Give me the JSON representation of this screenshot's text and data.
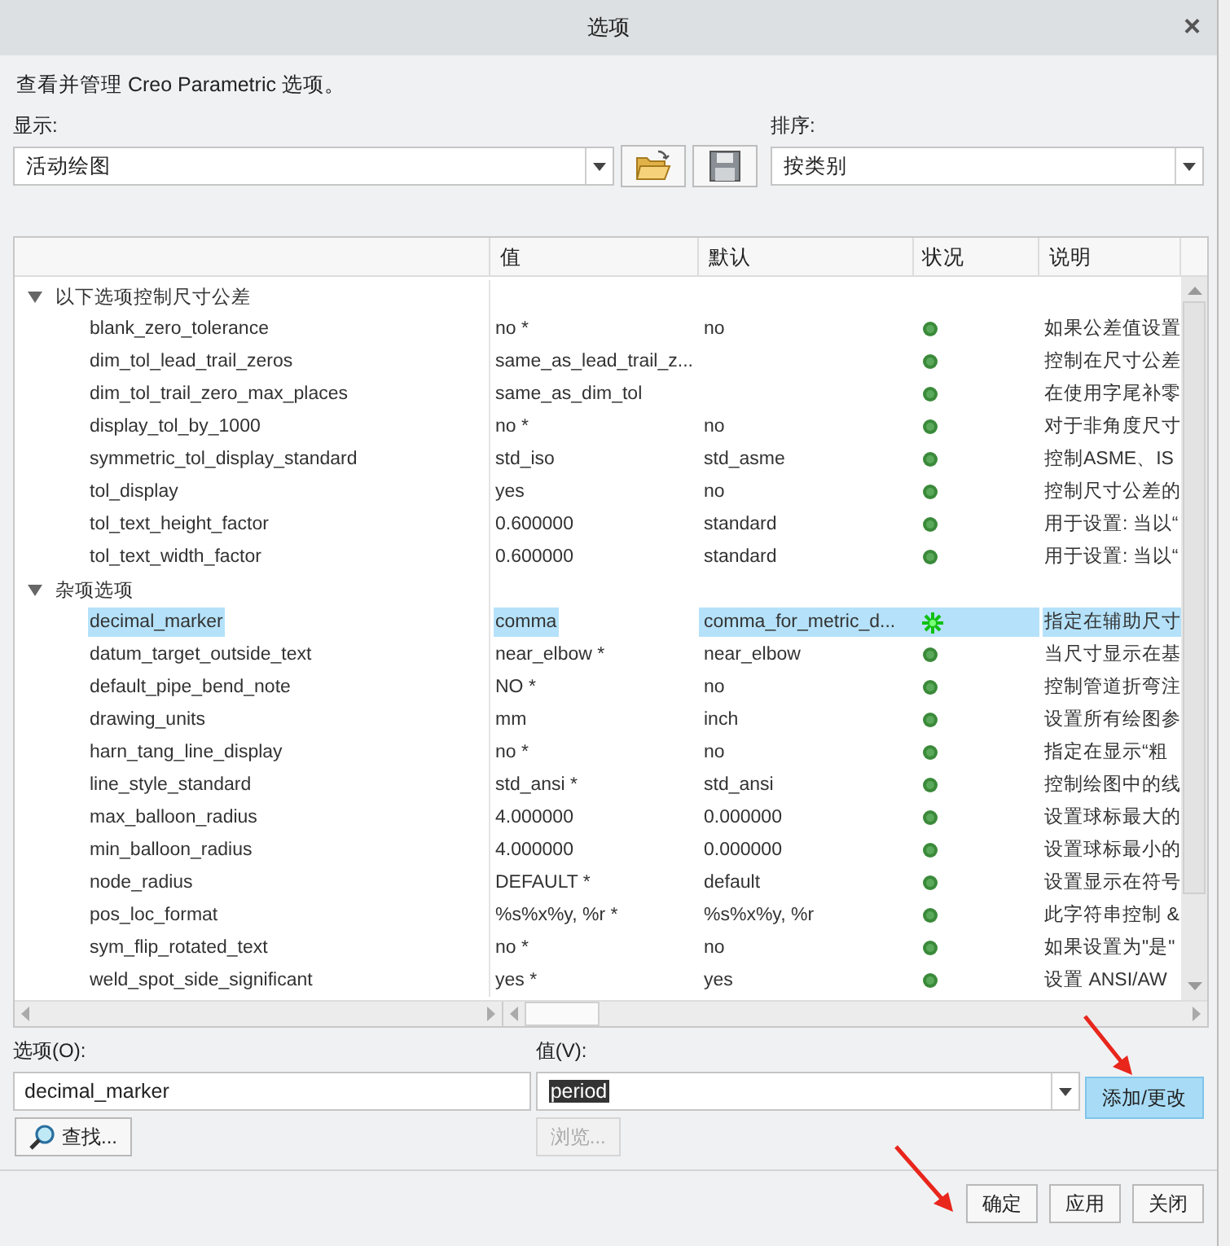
{
  "window": {
    "title": "选项",
    "close": "×"
  },
  "intro": "查看并管理 Creo Parametric 选项。",
  "show": {
    "label": "显示:",
    "value": "活动绘图"
  },
  "sort": {
    "label": "排序:",
    "value": "按类别"
  },
  "table": {
    "columns": [
      "值",
      "默认",
      "状况",
      "说明"
    ],
    "groups": [
      {
        "label": "以下选项控制尺寸公差",
        "expanded": true,
        "options": [
          {
            "name": "blank_zero_tolerance",
            "value": "no *",
            "default": "no",
            "modified": false,
            "description": "如果公差值设置",
            "selected": false
          },
          {
            "name": "dim_tol_lead_trail_zeros",
            "value": "same_as_lead_trail_z...",
            "modified": false,
            "description": "控制在尺寸公差",
            "selected": false
          },
          {
            "name": "dim_tol_trail_zero_max_places",
            "value": "same_as_dim_tol",
            "modified": false,
            "description": "在使用字尾补零",
            "selected": false
          },
          {
            "name": "display_tol_by_1000",
            "value": "no *",
            "default": "no",
            "modified": false,
            "description": "对于非角度尺寸",
            "selected": false
          },
          {
            "name": "symmetric_tol_display_standard",
            "value": "std_iso",
            "default": "std_asme",
            "modified": false,
            "description": "控制ASME、IS",
            "selected": false
          },
          {
            "name": "tol_display",
            "value": "yes",
            "default": "no",
            "modified": false,
            "description": "控制尺寸公差的",
            "selected": false
          },
          {
            "name": "tol_text_height_factor",
            "value": "0.600000",
            "default": "standard",
            "modified": false,
            "description": "用于设置: 当以“",
            "selected": false
          },
          {
            "name": "tol_text_width_factor",
            "value": "0.600000",
            "default": "standard",
            "modified": false,
            "description": "用于设置: 当以“",
            "selected": false
          }
        ]
      },
      {
        "label": "杂项选项",
        "expanded": true,
        "options": [
          {
            "name": "decimal_marker",
            "value": "comma",
            "default": "comma_for_metric_d...",
            "modified": true,
            "description": "指定在辅助尺寸",
            "selected": true
          },
          {
            "name": "datum_target_outside_text",
            "value": "near_elbow *",
            "default": "near_elbow",
            "modified": false,
            "description": "当尺寸显示在基",
            "selected": false
          },
          {
            "name": "default_pipe_bend_note",
            "value": "NO *",
            "default": "no",
            "modified": false,
            "description": "控制管道折弯注",
            "selected": false
          },
          {
            "name": "drawing_units",
            "value": "mm",
            "default": "inch",
            "modified": false,
            "description": "设置所有绘图参",
            "selected": false
          },
          {
            "name": "harn_tang_line_display",
            "value": "no *",
            "default": "no",
            "modified": false,
            "description": "指定在显示“粗",
            "selected": false
          },
          {
            "name": "line_style_standard",
            "value": "std_ansi *",
            "default": "std_ansi",
            "modified": false,
            "description": "控制绘图中的线",
            "selected": false
          },
          {
            "name": "max_balloon_radius",
            "value": "4.000000",
            "default": "0.000000",
            "modified": false,
            "description": "设置球标最大的",
            "selected": false
          },
          {
            "name": "min_balloon_radius",
            "value": "4.000000",
            "default": "0.000000",
            "modified": false,
            "description": "设置球标最小的",
            "selected": false
          },
          {
            "name": "node_radius",
            "value": "DEFAULT *",
            "default": "default",
            "modified": false,
            "description": "设置显示在符号",
            "selected": false
          },
          {
            "name": "pos_loc_format",
            "value": "%s%x%y, %r *",
            "default": "%s%x%y, %r",
            "modified": false,
            "description": "此字符串控制 &",
            "selected": false
          },
          {
            "name": "sym_flip_rotated_text",
            "value": "no *",
            "default": "no",
            "modified": false,
            "description": "如果设置为\"是\"",
            "selected": false
          },
          {
            "name": "weld_spot_side_significant",
            "value": "yes *",
            "default": "yes",
            "modified": false,
            "description": "设置 ANSI/AW",
            "selected": false
          }
        ]
      }
    ]
  },
  "option_field": {
    "label": "选项(O):",
    "value": "decimal_marker"
  },
  "value_field": {
    "label": "值(V):",
    "value": "period"
  },
  "find_button": "查找...",
  "browse_button": {
    "label": "浏览...",
    "disabled": true
  },
  "add_button": "添加/更改",
  "buttons": [
    "确定",
    "应用",
    "关闭"
  ]
}
